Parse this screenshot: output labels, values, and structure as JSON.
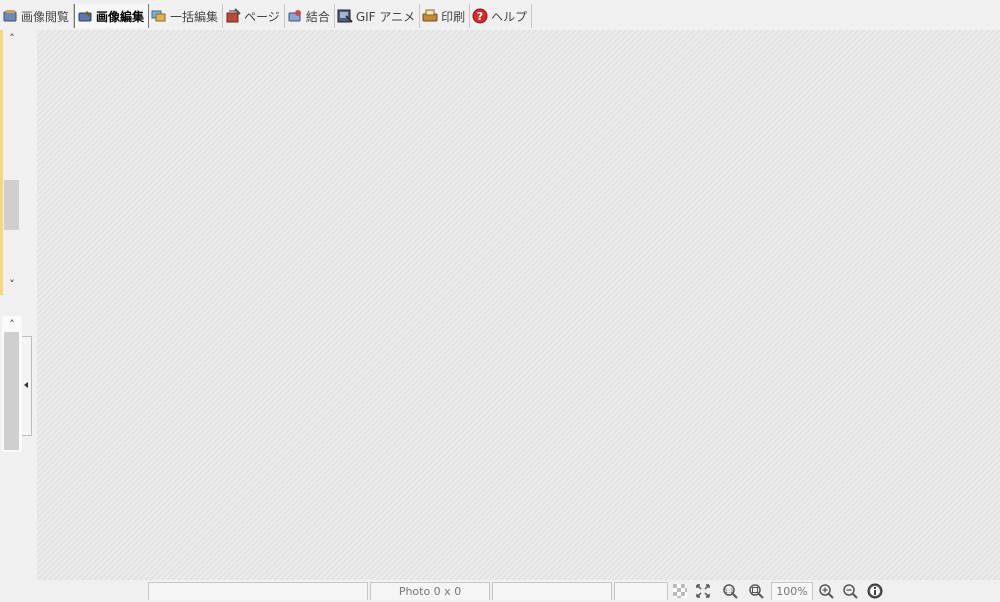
{
  "tabs": [
    {
      "label": "画像閲覧",
      "icon": "image-view-icon",
      "active": false
    },
    {
      "label": "画像編集",
      "icon": "image-edit-icon",
      "active": true
    },
    {
      "label": "一括編集",
      "icon": "batch-edit-icon",
      "active": false
    },
    {
      "label": "ページ",
      "icon": "page-icon",
      "active": false
    },
    {
      "label": "結合",
      "icon": "combine-icon",
      "active": false
    },
    {
      "label": "GIF アニメ",
      "icon": "gif-animation-icon",
      "active": false
    },
    {
      "label": "印刷",
      "icon": "print-icon",
      "active": false
    },
    {
      "label": "ヘルプ",
      "icon": "help-icon",
      "active": false
    }
  ],
  "sidebar": {
    "scroll_up": "˄",
    "scroll_down": "˅"
  },
  "status": {
    "photo_info": "Photo 0 x 0",
    "zoom": "100%"
  },
  "colors": {
    "accent_yellow": "#f3d97a",
    "help_red": "#d62b2b"
  }
}
